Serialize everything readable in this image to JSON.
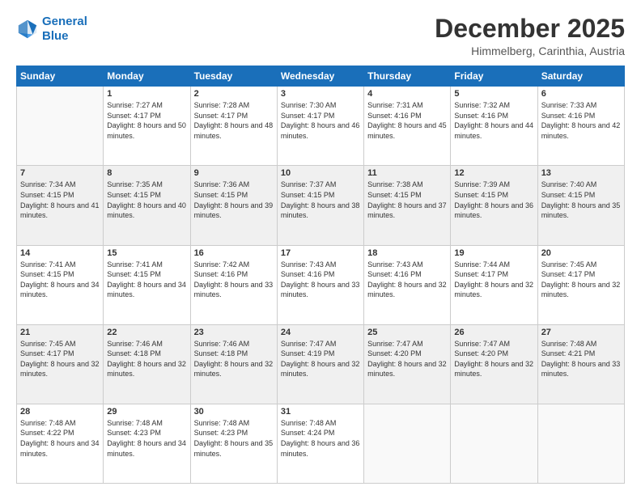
{
  "logo": {
    "line1": "General",
    "line2": "Blue"
  },
  "title": "December 2025",
  "location": "Himmelberg, Carinthia, Austria",
  "weekdays": [
    "Sunday",
    "Monday",
    "Tuesday",
    "Wednesday",
    "Thursday",
    "Friday",
    "Saturday"
  ],
  "weeks": [
    [
      {
        "day": "",
        "sunrise": "",
        "sunset": "",
        "daylight": ""
      },
      {
        "day": "1",
        "sunrise": "Sunrise: 7:27 AM",
        "sunset": "Sunset: 4:17 PM",
        "daylight": "Daylight: 8 hours and 50 minutes."
      },
      {
        "day": "2",
        "sunrise": "Sunrise: 7:28 AM",
        "sunset": "Sunset: 4:17 PM",
        "daylight": "Daylight: 8 hours and 48 minutes."
      },
      {
        "day": "3",
        "sunrise": "Sunrise: 7:30 AM",
        "sunset": "Sunset: 4:17 PM",
        "daylight": "Daylight: 8 hours and 46 minutes."
      },
      {
        "day": "4",
        "sunrise": "Sunrise: 7:31 AM",
        "sunset": "Sunset: 4:16 PM",
        "daylight": "Daylight: 8 hours and 45 minutes."
      },
      {
        "day": "5",
        "sunrise": "Sunrise: 7:32 AM",
        "sunset": "Sunset: 4:16 PM",
        "daylight": "Daylight: 8 hours and 44 minutes."
      },
      {
        "day": "6",
        "sunrise": "Sunrise: 7:33 AM",
        "sunset": "Sunset: 4:16 PM",
        "daylight": "Daylight: 8 hours and 42 minutes."
      }
    ],
    [
      {
        "day": "7",
        "sunrise": "Sunrise: 7:34 AM",
        "sunset": "Sunset: 4:15 PM",
        "daylight": "Daylight: 8 hours and 41 minutes."
      },
      {
        "day": "8",
        "sunrise": "Sunrise: 7:35 AM",
        "sunset": "Sunset: 4:15 PM",
        "daylight": "Daylight: 8 hours and 40 minutes."
      },
      {
        "day": "9",
        "sunrise": "Sunrise: 7:36 AM",
        "sunset": "Sunset: 4:15 PM",
        "daylight": "Daylight: 8 hours and 39 minutes."
      },
      {
        "day": "10",
        "sunrise": "Sunrise: 7:37 AM",
        "sunset": "Sunset: 4:15 PM",
        "daylight": "Daylight: 8 hours and 38 minutes."
      },
      {
        "day": "11",
        "sunrise": "Sunrise: 7:38 AM",
        "sunset": "Sunset: 4:15 PM",
        "daylight": "Daylight: 8 hours and 37 minutes."
      },
      {
        "day": "12",
        "sunrise": "Sunrise: 7:39 AM",
        "sunset": "Sunset: 4:15 PM",
        "daylight": "Daylight: 8 hours and 36 minutes."
      },
      {
        "day": "13",
        "sunrise": "Sunrise: 7:40 AM",
        "sunset": "Sunset: 4:15 PM",
        "daylight": "Daylight: 8 hours and 35 minutes."
      }
    ],
    [
      {
        "day": "14",
        "sunrise": "Sunrise: 7:41 AM",
        "sunset": "Sunset: 4:15 PM",
        "daylight": "Daylight: 8 hours and 34 minutes."
      },
      {
        "day": "15",
        "sunrise": "Sunrise: 7:41 AM",
        "sunset": "Sunset: 4:15 PM",
        "daylight": "Daylight: 8 hours and 34 minutes."
      },
      {
        "day": "16",
        "sunrise": "Sunrise: 7:42 AM",
        "sunset": "Sunset: 4:16 PM",
        "daylight": "Daylight: 8 hours and 33 minutes."
      },
      {
        "day": "17",
        "sunrise": "Sunrise: 7:43 AM",
        "sunset": "Sunset: 4:16 PM",
        "daylight": "Daylight: 8 hours and 33 minutes."
      },
      {
        "day": "18",
        "sunrise": "Sunrise: 7:43 AM",
        "sunset": "Sunset: 4:16 PM",
        "daylight": "Daylight: 8 hours and 32 minutes."
      },
      {
        "day": "19",
        "sunrise": "Sunrise: 7:44 AM",
        "sunset": "Sunset: 4:17 PM",
        "daylight": "Daylight: 8 hours and 32 minutes."
      },
      {
        "day": "20",
        "sunrise": "Sunrise: 7:45 AM",
        "sunset": "Sunset: 4:17 PM",
        "daylight": "Daylight: 8 hours and 32 minutes."
      }
    ],
    [
      {
        "day": "21",
        "sunrise": "Sunrise: 7:45 AM",
        "sunset": "Sunset: 4:17 PM",
        "daylight": "Daylight: 8 hours and 32 minutes."
      },
      {
        "day": "22",
        "sunrise": "Sunrise: 7:46 AM",
        "sunset": "Sunset: 4:18 PM",
        "daylight": "Daylight: 8 hours and 32 minutes."
      },
      {
        "day": "23",
        "sunrise": "Sunrise: 7:46 AM",
        "sunset": "Sunset: 4:18 PM",
        "daylight": "Daylight: 8 hours and 32 minutes."
      },
      {
        "day": "24",
        "sunrise": "Sunrise: 7:47 AM",
        "sunset": "Sunset: 4:19 PM",
        "daylight": "Daylight: 8 hours and 32 minutes."
      },
      {
        "day": "25",
        "sunrise": "Sunrise: 7:47 AM",
        "sunset": "Sunset: 4:20 PM",
        "daylight": "Daylight: 8 hours and 32 minutes."
      },
      {
        "day": "26",
        "sunrise": "Sunrise: 7:47 AM",
        "sunset": "Sunset: 4:20 PM",
        "daylight": "Daylight: 8 hours and 32 minutes."
      },
      {
        "day": "27",
        "sunrise": "Sunrise: 7:48 AM",
        "sunset": "Sunset: 4:21 PM",
        "daylight": "Daylight: 8 hours and 33 minutes."
      }
    ],
    [
      {
        "day": "28",
        "sunrise": "Sunrise: 7:48 AM",
        "sunset": "Sunset: 4:22 PM",
        "daylight": "Daylight: 8 hours and 34 minutes."
      },
      {
        "day": "29",
        "sunrise": "Sunrise: 7:48 AM",
        "sunset": "Sunset: 4:23 PM",
        "daylight": "Daylight: 8 hours and 34 minutes."
      },
      {
        "day": "30",
        "sunrise": "Sunrise: 7:48 AM",
        "sunset": "Sunset: 4:23 PM",
        "daylight": "Daylight: 8 hours and 35 minutes."
      },
      {
        "day": "31",
        "sunrise": "Sunrise: 7:48 AM",
        "sunset": "Sunset: 4:24 PM",
        "daylight": "Daylight: 8 hours and 36 minutes."
      },
      {
        "day": "",
        "sunrise": "",
        "sunset": "",
        "daylight": ""
      },
      {
        "day": "",
        "sunrise": "",
        "sunset": "",
        "daylight": ""
      },
      {
        "day": "",
        "sunrise": "",
        "sunset": "",
        "daylight": ""
      }
    ]
  ]
}
